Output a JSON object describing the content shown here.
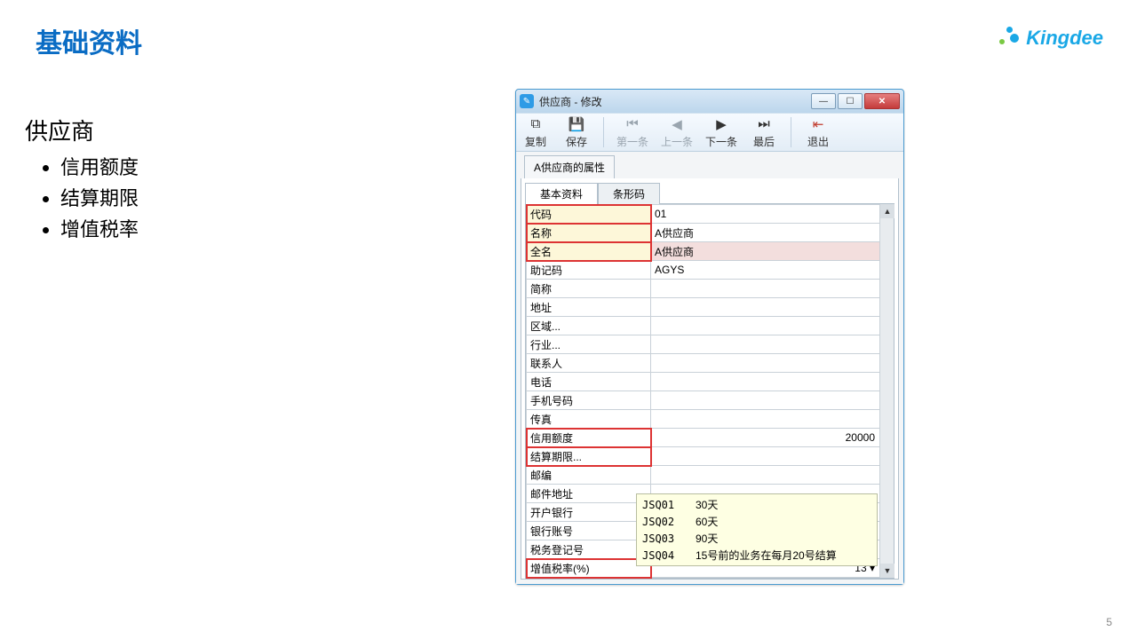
{
  "slide": {
    "title": "基础资料",
    "page": "5"
  },
  "logo": {
    "text": "Kingdee"
  },
  "sidenote": {
    "heading": "供应商",
    "items": [
      "信用额度",
      "结算期限",
      "增值税率"
    ]
  },
  "window": {
    "title": "供应商 - 修改",
    "toolbar": {
      "copy": "复制",
      "save": "保存",
      "first": "第一条",
      "prev": "上一条",
      "next": "下一条",
      "last": "最后",
      "exit": "退出"
    },
    "prop_tab": "A供应商的属性",
    "sub_tabs": {
      "basic": "基本资料",
      "barcode": "条形码"
    },
    "rows": [
      {
        "label": "代码",
        "value": "01",
        "hl": "yellow red"
      },
      {
        "label": "名称",
        "value": "A供应商",
        "hl": "yellow red"
      },
      {
        "label": "全名",
        "value": "A供应商",
        "hl": "yellow red pink"
      },
      {
        "label": "助记码",
        "value": "AGYS"
      },
      {
        "label": "简称",
        "value": ""
      },
      {
        "label": "地址",
        "value": ""
      },
      {
        "label": "区域...",
        "value": ""
      },
      {
        "label": "行业...",
        "value": ""
      },
      {
        "label": "联系人",
        "value": ""
      },
      {
        "label": "电话",
        "value": ""
      },
      {
        "label": "手机号码",
        "value": ""
      },
      {
        "label": "传真",
        "value": ""
      },
      {
        "label": "信用额度",
        "value": "20000",
        "hl": "red",
        "right": true
      },
      {
        "label": "结算期限...",
        "value": "",
        "hl": "red"
      },
      {
        "label": "邮编",
        "value": ""
      },
      {
        "label": "邮件地址",
        "value": ""
      },
      {
        "label": "开户银行",
        "value": ""
      },
      {
        "label": "银行账号",
        "value": ""
      },
      {
        "label": "税务登记号",
        "value": ""
      },
      {
        "label": "增值税率(%)",
        "value": "13",
        "hl": "red",
        "right": true,
        "dropdown": true
      }
    ],
    "tooltip": [
      {
        "code": "JSQ01",
        "text": "30天"
      },
      {
        "code": "JSQ02",
        "text": "60天"
      },
      {
        "code": "JSQ03",
        "text": "90天"
      },
      {
        "code": "JSQ04",
        "text": "15号前的业务在每月20号结算"
      }
    ]
  }
}
